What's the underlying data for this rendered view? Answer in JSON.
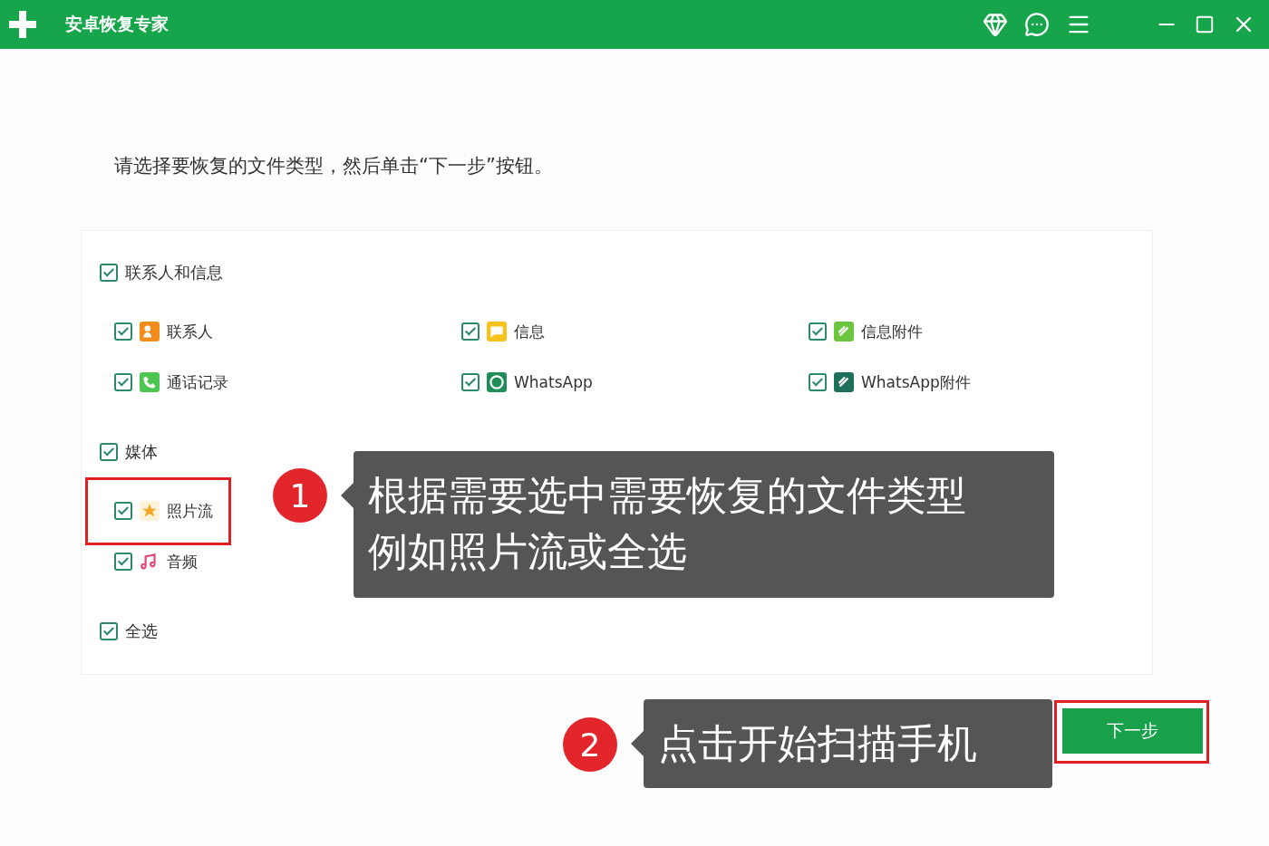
{
  "window": {
    "title": "安卓恢复专家"
  },
  "instruction": "请选择要恢复的文件类型，然后单击“下一步”按钮。",
  "groups": [
    {
      "label": "联系人和信息",
      "checked": true,
      "items": [
        {
          "label": "联系人",
          "checked": true,
          "kind": "contact",
          "highlighted": false
        },
        {
          "label": "通话记录",
          "checked": true,
          "kind": "call",
          "highlighted": false
        },
        {
          "label": "信息",
          "checked": true,
          "kind": "message",
          "highlighted": false
        },
        {
          "label": "WhatsApp",
          "checked": true,
          "kind": "whatsapp",
          "highlighted": false
        },
        {
          "label": "信息附件",
          "checked": true,
          "kind": "attachment",
          "highlighted": false
        },
        {
          "label": "WhatsApp附件",
          "checked": true,
          "kind": "whatsapp_attachment",
          "highlighted": false
        }
      ]
    },
    {
      "label": "媒体",
      "checked": true,
      "items": [
        {
          "label": "照片流",
          "checked": true,
          "kind": "photostream",
          "highlighted": true
        },
        {
          "label": "音频",
          "checked": true,
          "kind": "audio",
          "highlighted": false
        }
      ]
    }
  ],
  "select_all": {
    "label": "全选",
    "checked": true
  },
  "next_button": {
    "label": "下一步",
    "highlighted": true
  },
  "annotations": [
    {
      "number": "1",
      "lines": [
        "根据需要选中需要恢复的文件类型",
        "例如照片流或全选"
      ]
    },
    {
      "number": "2",
      "lines": [
        "点击开始扫描手机"
      ]
    }
  ]
}
